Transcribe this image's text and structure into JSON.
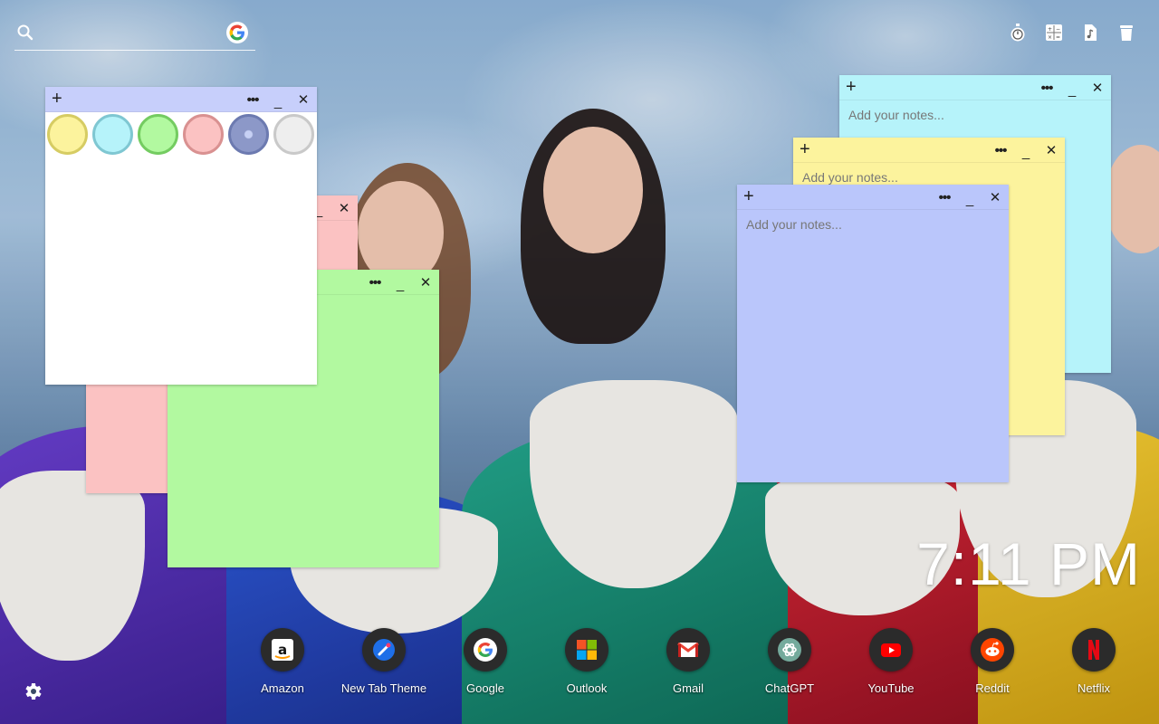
{
  "search": {
    "value": "",
    "placeholder": "",
    "icon": "search-icon",
    "engine_icon": "google-icon"
  },
  "top_tools": [
    {
      "name": "timer-icon"
    },
    {
      "name": "calculator-icon"
    },
    {
      "name": "music-file-icon"
    },
    {
      "name": "trash-icon"
    }
  ],
  "notes": {
    "add_label": "+",
    "more_label": "•••",
    "minimize_label": "_",
    "close_label": "✕",
    "placeholder": "Add your notes...",
    "palette": [
      {
        "fill": "#fcf39d",
        "border": "#d6cc63",
        "name": "yellow"
      },
      {
        "fill": "#b6f3fa",
        "border": "#7fc7d2",
        "name": "cyan"
      },
      {
        "fill": "#b2f9a0",
        "border": "#74cc61",
        "name": "green"
      },
      {
        "fill": "#fbc2c2",
        "border": "#d99191",
        "name": "pink"
      },
      {
        "fill": "#8c98c8",
        "border": "#6c7ab0",
        "name": "blue-selected"
      },
      {
        "fill": "#eeeeee",
        "border": "#c9c9c9",
        "name": "gray"
      }
    ],
    "colors": {
      "white_header": "#c7cffb",
      "pink": "#fbc2c2",
      "green": "#b2f9a0",
      "cyan": "#b6f3fa",
      "yellow": "#fcf39d",
      "blue": "#bac6fb"
    }
  },
  "clock": {
    "time": "7:11 PM"
  },
  "dock": [
    {
      "label": "Amazon",
      "icon": "amazon-icon"
    },
    {
      "label": "New Tab Theme",
      "icon": "new-tab-theme-icon"
    },
    {
      "label": "Google",
      "icon": "google-icon"
    },
    {
      "label": "Outlook",
      "icon": "outlook-icon"
    },
    {
      "label": "Gmail",
      "icon": "gmail-icon"
    },
    {
      "label": "ChatGPT",
      "icon": "chatgpt-icon"
    },
    {
      "label": "YouTube",
      "icon": "youtube-icon"
    },
    {
      "label": "Reddit",
      "icon": "reddit-icon"
    },
    {
      "label": "Netflix",
      "icon": "netflix-icon"
    }
  ],
  "settings": {
    "icon": "gear-icon"
  }
}
